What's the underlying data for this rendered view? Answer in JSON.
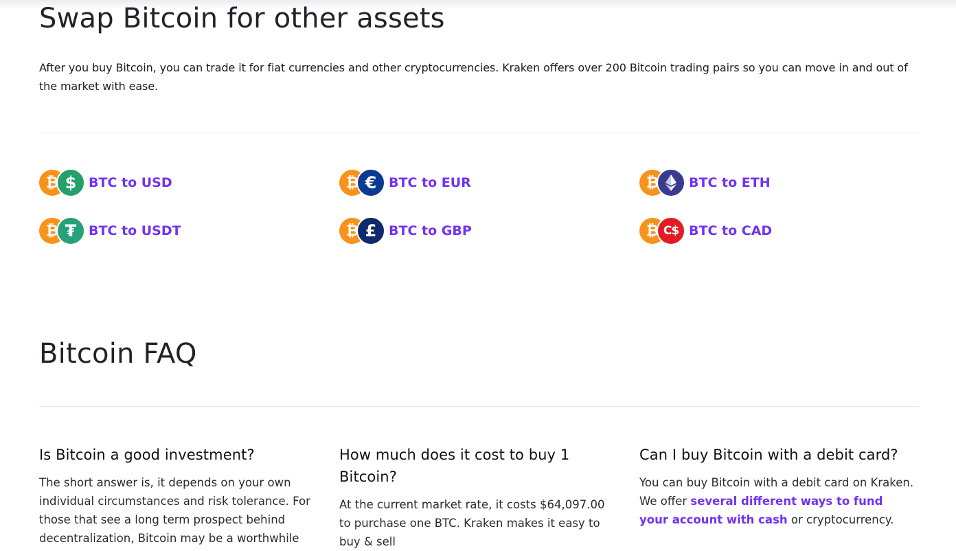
{
  "swap": {
    "title": "Swap Bitcoin for other assets",
    "description": "After you buy Bitcoin, you can trade it for fiat currencies and other cryptocurrencies. Kraken offers over 200 Bitcoin trading pairs so you can move in and out of the market with ease.",
    "pairs": [
      {
        "label": "BTC to USD",
        "base_icon": "bitcoin-icon",
        "quote_icon": "usd-icon",
        "quote_glyph": "$",
        "quote_color": "#24a06b"
      },
      {
        "label": "BTC to EUR",
        "base_icon": "bitcoin-icon",
        "quote_icon": "euro-icon",
        "quote_glyph": "€",
        "quote_color": "#0b3a93"
      },
      {
        "label": "BTC to ETH",
        "base_icon": "bitcoin-icon",
        "quote_icon": "ethereum-icon",
        "quote_glyph": "",
        "quote_color": "#3b3b8e"
      },
      {
        "label": "BTC to USDT",
        "base_icon": "bitcoin-icon",
        "quote_icon": "tether-icon",
        "quote_glyph": "₮",
        "quote_color": "#26a17b"
      },
      {
        "label": "BTC to GBP",
        "base_icon": "bitcoin-icon",
        "quote_icon": "pound-icon",
        "quote_glyph": "£",
        "quote_color": "#0f2a6b"
      },
      {
        "label": "BTC to CAD",
        "base_icon": "bitcoin-icon",
        "quote_icon": "cad-icon",
        "quote_glyph": "C$",
        "quote_color": "#e31b23"
      }
    ],
    "base_glyph": "₿",
    "base_color": "#f7931a"
  },
  "faq": {
    "title": "Bitcoin FAQ",
    "items": [
      {
        "question": "Is Bitcoin a good investment?",
        "answer": "The short answer is, it depends on your own individual circumstances and risk tolerance. For those that see a long term prospect behind decentralization, Bitcoin may be a worthwhile"
      },
      {
        "question": "How much does it cost to buy 1 Bitcoin?",
        "answer": "At the current market rate, it costs $64,097.00 to purchase one BTC. Kraken makes it easy to buy & sell"
      },
      {
        "question": "Can I buy Bitcoin with a debit card?",
        "answer_pre": "You can buy Bitcoin with a debit card on Kraken. We offer ",
        "answer_link": "several different ways to fund your account with cash",
        "answer_post": " or cryptocurrency."
      }
    ]
  },
  "colors": {
    "accent": "#7132f5",
    "text": "#101114",
    "divider": "#e6e6ea"
  }
}
